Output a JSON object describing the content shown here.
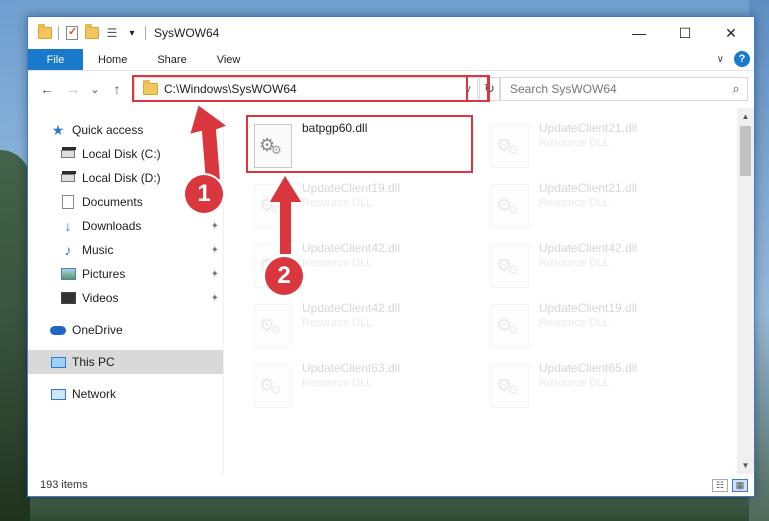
{
  "window": {
    "title": "SysWOW64",
    "controls": {
      "minimize": "—",
      "maximize": "☐",
      "close": "✕"
    }
  },
  "quick_access_toolbar": {
    "dropdown_glyph": "▾"
  },
  "ribbon": {
    "tabs": [
      "File",
      "Home",
      "Share",
      "View"
    ],
    "help_glyph": "?",
    "collapse_glyph": "∨"
  },
  "nav": {
    "back": "←",
    "forward": "→",
    "recent": "⌄",
    "up": "↑"
  },
  "address": {
    "path": "C:\\Windows\\SysWOW64",
    "dropdown": "∨",
    "refresh": "↻"
  },
  "search": {
    "placeholder": "Search SysWOW64",
    "icon": "search-icon",
    "glyph": "⌕"
  },
  "sidebar": {
    "items": [
      {
        "label": "Quick access",
        "icon": "star-icon",
        "pinned": false
      },
      {
        "label": "Local Disk (C:)",
        "icon": "drive-icon",
        "pinned": true
      },
      {
        "label": "Local Disk (D:)",
        "icon": "drive-icon",
        "pinned": true
      },
      {
        "label": "Documents",
        "icon": "documents-icon",
        "pinned": true
      },
      {
        "label": "Downloads",
        "icon": "downloads-icon",
        "pinned": true
      },
      {
        "label": "Music",
        "icon": "music-icon",
        "pinned": true
      },
      {
        "label": "Pictures",
        "icon": "pictures-icon",
        "pinned": true
      },
      {
        "label": "Videos",
        "icon": "videos-icon",
        "pinned": true
      },
      {
        "label": "OneDrive",
        "icon": "onedrive-icon",
        "pinned": false
      },
      {
        "label": "This PC",
        "icon": "this-pc-icon",
        "pinned": false,
        "selected": true
      },
      {
        "label": "Network",
        "icon": "network-icon",
        "pinned": false
      }
    ],
    "pin_glyph": "📌"
  },
  "files": [
    {
      "name": "batpgp60.dll",
      "type": "",
      "faded": false
    },
    {
      "name": "UpdateClient21.dll",
      "type": "Resource DLL",
      "faded": true
    },
    {
      "name": "UpdateClient19.dll",
      "type": "Resource DLL",
      "faded": true
    },
    {
      "name": "UpdateClient21.dll",
      "type": "Resource DLL",
      "faded": true
    },
    {
      "name": "UpdateClient42.dll",
      "type": "Resource DLL",
      "faded": true
    },
    {
      "name": "UpdateClient42.dll",
      "type": "Resource DLL",
      "faded": true
    },
    {
      "name": "UpdateClient42.dll",
      "type": "Resource DLL",
      "faded": true
    },
    {
      "name": "UpdateClient19.dll",
      "type": "Resource DLL",
      "faded": true
    },
    {
      "name": "UpdateClient63.dll",
      "type": "Resource DLL",
      "faded": true
    },
    {
      "name": "UpdateClient65.dll",
      "type": "Resource DLL",
      "faded": true
    }
  ],
  "status": {
    "item_count": "193 items"
  },
  "annotations": [
    {
      "number": "1",
      "target": "address-bar"
    },
    {
      "number": "2",
      "target": "batpgp60.dll"
    }
  ],
  "colors": {
    "accent": "#1979ca",
    "highlight": "#d9363e"
  }
}
